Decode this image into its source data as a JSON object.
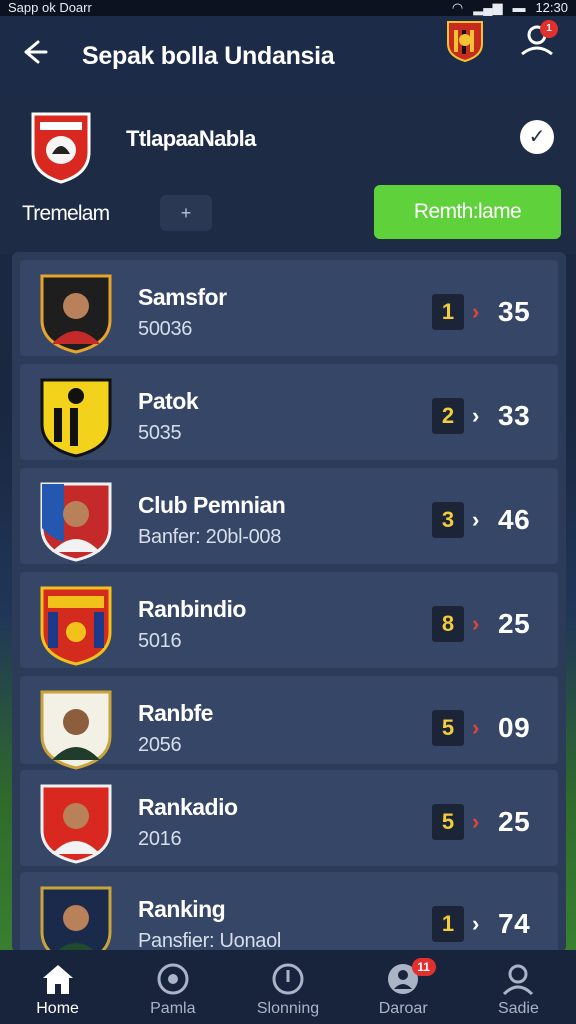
{
  "status_bar": {
    "left": "Sapp ok Doarr",
    "time": "12:30"
  },
  "header": {
    "title": "Sepak bolla Undansia",
    "notification_count": "1"
  },
  "team": {
    "name": "TtlapaaNabla",
    "sub_label": "Tremelam",
    "small_button": "+",
    "action_button": "Remth:lame"
  },
  "players": [
    {
      "name": "Samsfor",
      "sub": "50036",
      "rank": "1",
      "arrow_color": "#e0463c",
      "score": "35"
    },
    {
      "name": "Patok",
      "sub": "5035",
      "rank": "2",
      "arrow_color": "#ffffff",
      "score": "33"
    },
    {
      "name": "Club Pemnian",
      "sub": "Banfer: 20bl-008",
      "rank": "3",
      "arrow_color": "#ffffff",
      "score": "46"
    },
    {
      "name": "Ranbindio",
      "sub": "5016",
      "rank": "8",
      "arrow_color": "#e0463c",
      "score": "25"
    },
    {
      "name": "Ranbfe",
      "sub": "2056",
      "rank": "5",
      "arrow_color": "#e0463c",
      "score": "09"
    },
    {
      "name": "Rankadio",
      "sub": "2016",
      "rank": "5",
      "arrow_color": "#e0463c",
      "score": "25"
    },
    {
      "name": "Ranking",
      "sub": "Pansfier: Uonaol",
      "rank": "1",
      "arrow_color": "#ffffff",
      "score": "74"
    }
  ],
  "bottom_nav": [
    {
      "label": "Home",
      "icon": "home-icon",
      "active": true
    },
    {
      "label": "Pamla",
      "icon": "ball-icon"
    },
    {
      "label": "Slonning",
      "icon": "clock-icon"
    },
    {
      "label": "Daroar",
      "icon": "user-circle-icon",
      "badge": "11"
    },
    {
      "label": "Sadie",
      "icon": "profile-icon"
    }
  ],
  "colors": {
    "accent_green": "#5fd13b",
    "badge_red": "#e2302e",
    "rank_yellow": "#f3cc3a"
  }
}
